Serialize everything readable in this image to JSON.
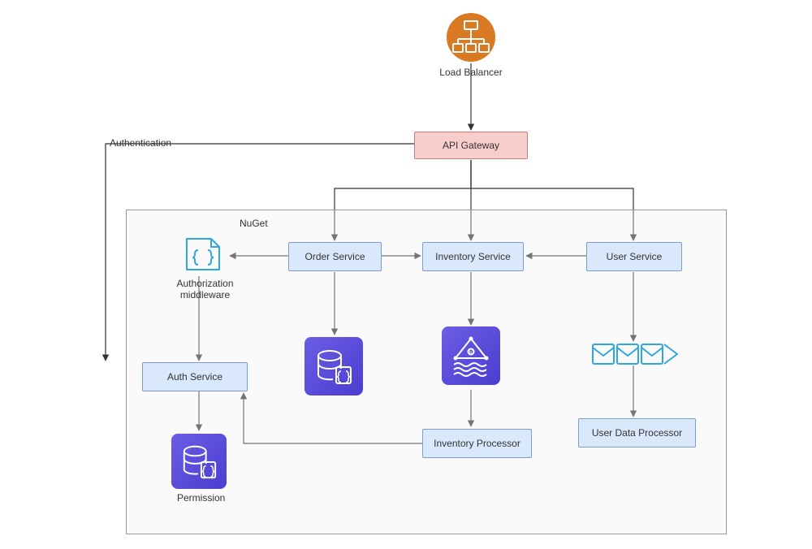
{
  "diagram": {
    "load_balancer_label": "Load Balancer",
    "api_gateway_label": "API Gateway",
    "authentication_edge_label": "Authentication",
    "container_label": "NuGet",
    "auth_middleware_label": "Authorization\nmiddleware",
    "order_service_label": "Order Service",
    "inventory_service_label": "Inventory Service",
    "user_service_label": "User Service",
    "auth_service_label": "Auth Service",
    "inventory_processor_label": "Inventory Processor",
    "user_data_processor_label": "User Data Processor",
    "permission_label": "Permission",
    "icons": {
      "load_balancer": "load-balancer-icon",
      "auth_middleware": "code-braces-icon",
      "order_db": "database-code-icon",
      "inventory_stream": "kinesis-stream-icon",
      "user_queue": "message-queue-icon",
      "permission_db": "database-code-icon"
    },
    "colors": {
      "node_blue_fill": "#dae8fc",
      "node_blue_stroke": "#7a9ed1",
      "node_pink_fill": "#f8cecc",
      "node_pink_stroke": "#c07f7d",
      "orange": "#d97a22",
      "purple_a": "#6b5de4",
      "purple_b": "#4b3ed0",
      "queue_blue": "#2fa7df"
    }
  }
}
